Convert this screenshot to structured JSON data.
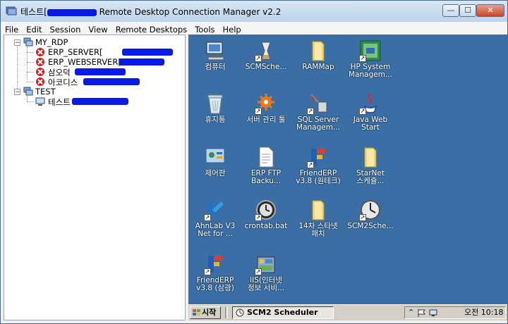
{
  "window": {
    "title_prefix": "테스트[",
    "title": "Remote Desktop Connection Manager v2.2",
    "minimize": "—",
    "maximize": "☐",
    "close": "✕"
  },
  "menu": [
    "File",
    "Edit",
    "Session",
    "View",
    "Remote Desktops",
    "Tools",
    "Help"
  ],
  "tree": {
    "groups": [
      {
        "label": "MY_RDP",
        "toggle": "−",
        "icon": "server-group-icon",
        "items": [
          {
            "label": "ERP_SERVER[",
            "status": "disconnected"
          },
          {
            "label": "ERP_WEBSERVER[",
            "status": "disconnected"
          },
          {
            "label": "삼오덕",
            "status": "disconnected"
          },
          {
            "label": "아코디스",
            "status": "disconnected"
          }
        ]
      },
      {
        "label": "TEST",
        "toggle": "−",
        "icon": "server-group-icon",
        "items": [
          {
            "label": "테스트",
            "status": "connected"
          }
        ]
      }
    ]
  },
  "desktop": {
    "icons": [
      {
        "label": "컴퓨터",
        "icon": "computer-icon"
      },
      {
        "label": "SCMSche...",
        "icon": "scheduler-icon"
      },
      {
        "label": "RAMMap",
        "icon": "folder-icon"
      },
      {
        "label": "HP System\nManagem...",
        "icon": "hp-system-management-icon"
      },
      {
        "label": "휴지통",
        "icon": "recycle-bin-icon"
      },
      {
        "label": "서버 관리 툴",
        "icon": "server-tools-icon"
      },
      {
        "label": "SQL Server\nManagem...",
        "icon": "sql-server-icon"
      },
      {
        "label": "Java Web\nStart",
        "icon": "java-icon"
      },
      {
        "label": "제어판",
        "icon": "control-panel-icon"
      },
      {
        "label": "ERP FTP\nBacku...",
        "icon": "document-icon"
      },
      {
        "label": "FriendERP\nv3.8 (원테크)",
        "icon": "frienderp-icon"
      },
      {
        "label": "StarNet\n스케쥴...",
        "icon": "folder-icon"
      },
      {
        "label": "AhnLab V3\nNet for ...",
        "icon": "ahnlab-icon"
      },
      {
        "label": "crontab.bat",
        "icon": "batch-file-icon"
      },
      {
        "label": "14차 스타넷\n패치",
        "icon": "folder-icon"
      },
      {
        "label": "SCM2Sche...",
        "icon": "scheduler-icon"
      },
      {
        "label": "FriendERP\nv3.8 (삼광)",
        "icon": "frienderp-icon"
      },
      {
        "label": "IIS(인터넷\n정보 서비...",
        "icon": "iis-icon"
      }
    ],
    "taskbar": {
      "start_label": "시작",
      "task_label": "SCM2 Scheduler",
      "clock": "오전 10:18"
    }
  },
  "colors": {
    "desktop": "#3a6ea5",
    "redaction": "#0a1ae6",
    "disconnected": "#d42020"
  }
}
